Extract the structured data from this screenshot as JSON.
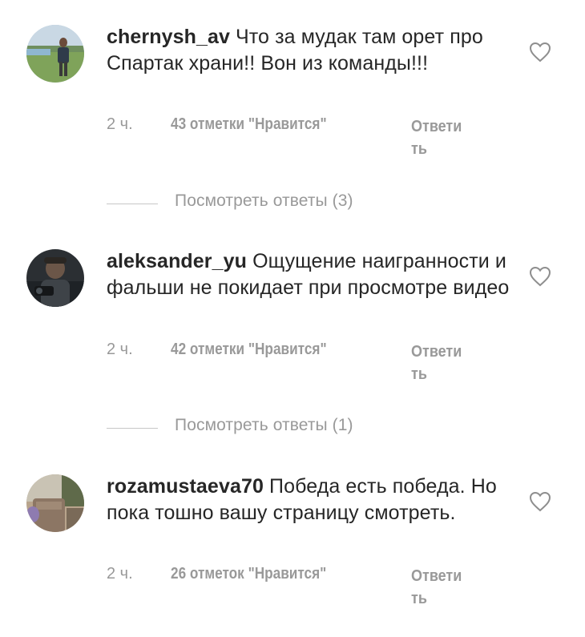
{
  "comments": [
    {
      "username": "chernysh_av",
      "text": "Что за мудак там орет про Спартак храни!! Вон из команды!!!",
      "time": "2 ч.",
      "likes": "43 отметки \"Нравится\"",
      "reply_label": "Ответить",
      "view_replies": "Посмотреть ответы (3)"
    },
    {
      "username": "aleksander_yu",
      "text": "Ощущение наигранности и фальши не покидает при просмотре видео",
      "time": "2 ч.",
      "likes": "42 отметки \"Нравится\"",
      "reply_label": "Ответить",
      "view_replies": "Посмотреть ответы (1)"
    },
    {
      "username": "rozamustaeva70",
      "text": "Победа есть победа. Но пока тошно вашу страницу смотреть.",
      "time": "2 ч.",
      "likes": "26 отметок \"Нравится\"",
      "reply_label": "Ответить"
    }
  ],
  "icons": {
    "like": "heart-outline-icon"
  },
  "colors": {
    "text": "#262626",
    "secondary": "#999999",
    "divider": "#c7c7c7"
  }
}
